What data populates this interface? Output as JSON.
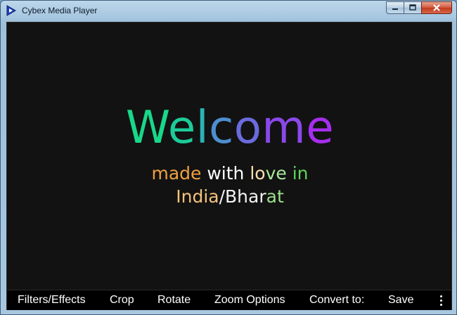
{
  "window": {
    "title": "Cybex Media Player",
    "icon": "play-triangle-icon",
    "controls": [
      "minimize-icon",
      "maximize-icon",
      "close-icon"
    ]
  },
  "splash": {
    "welcome_letters": [
      {
        "ch": "W",
        "color": "#18d88a"
      },
      {
        "ch": "e",
        "color": "#1ccc9a"
      },
      {
        "ch": "l",
        "color": "#2bb3b4"
      },
      {
        "ch": "c",
        "color": "#4d8ed0"
      },
      {
        "ch": "o",
        "color": "#6b6ade"
      },
      {
        "ch": "m",
        "color": "#8a48ea"
      },
      {
        "ch": "e",
        "color": "#a62ef0"
      }
    ],
    "line1": [
      {
        "text": "made",
        "color": "#f0a040"
      },
      {
        "text": " with ",
        "color": "#ffffff"
      },
      {
        "text": "lo",
        "color": "#ffe0b0"
      },
      {
        "text": "ve",
        "color": "#a8e89a"
      },
      {
        "text": " in",
        "color": "#5fd45a"
      }
    ],
    "line2": [
      {
        "text": "India",
        "color": "#f5c27a"
      },
      {
        "text": "/Bhar",
        "color": "#f3f3f3"
      },
      {
        "text": "at",
        "color": "#9be08a"
      }
    ]
  },
  "toolbar": {
    "filters": "Filters/Effects",
    "crop": "Crop",
    "rotate": "Rotate",
    "zoom": "Zoom Options",
    "convert": "Convert to:",
    "save": "Save",
    "more_icon": "vertical-ellipsis-icon"
  }
}
